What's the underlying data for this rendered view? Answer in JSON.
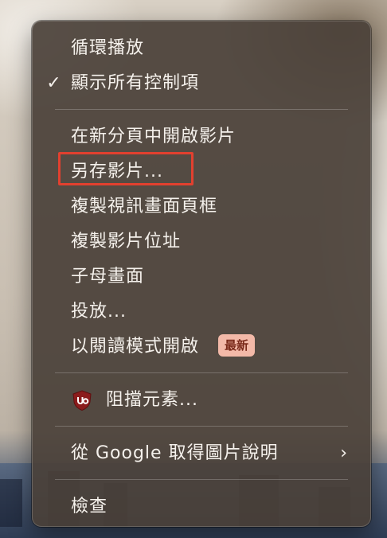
{
  "menu": {
    "loop_label": "循環播放",
    "show_controls_check": "✓",
    "show_controls_label": "顯示所有控制項",
    "open_in_tab_label": "在新分頁中開啟影片",
    "save_video_label": "另存影片...",
    "copy_frame_label": "複製視訊畫面頁框",
    "copy_address_label": "複製影片位址",
    "pip_label": "子母畫面",
    "cast_label": "投放...",
    "reader_mode_label": "以閱讀模式開啟",
    "reader_mode_badge": "最新",
    "block_element_label": "阻擋元素...",
    "google_lens_label": "從 Google 取得圖片說明",
    "google_lens_arrow": "›",
    "inspect_label": "檢查"
  },
  "colors": {
    "highlight_border": "#e2402f",
    "badge_bg": "#f3b9a8",
    "ublock_shield": "#8b1c1c"
  },
  "icons": {
    "ublock": "ublock-origin-shield-icon",
    "checkmark": "checkmark-icon",
    "submenu": "chevron-right-icon"
  }
}
